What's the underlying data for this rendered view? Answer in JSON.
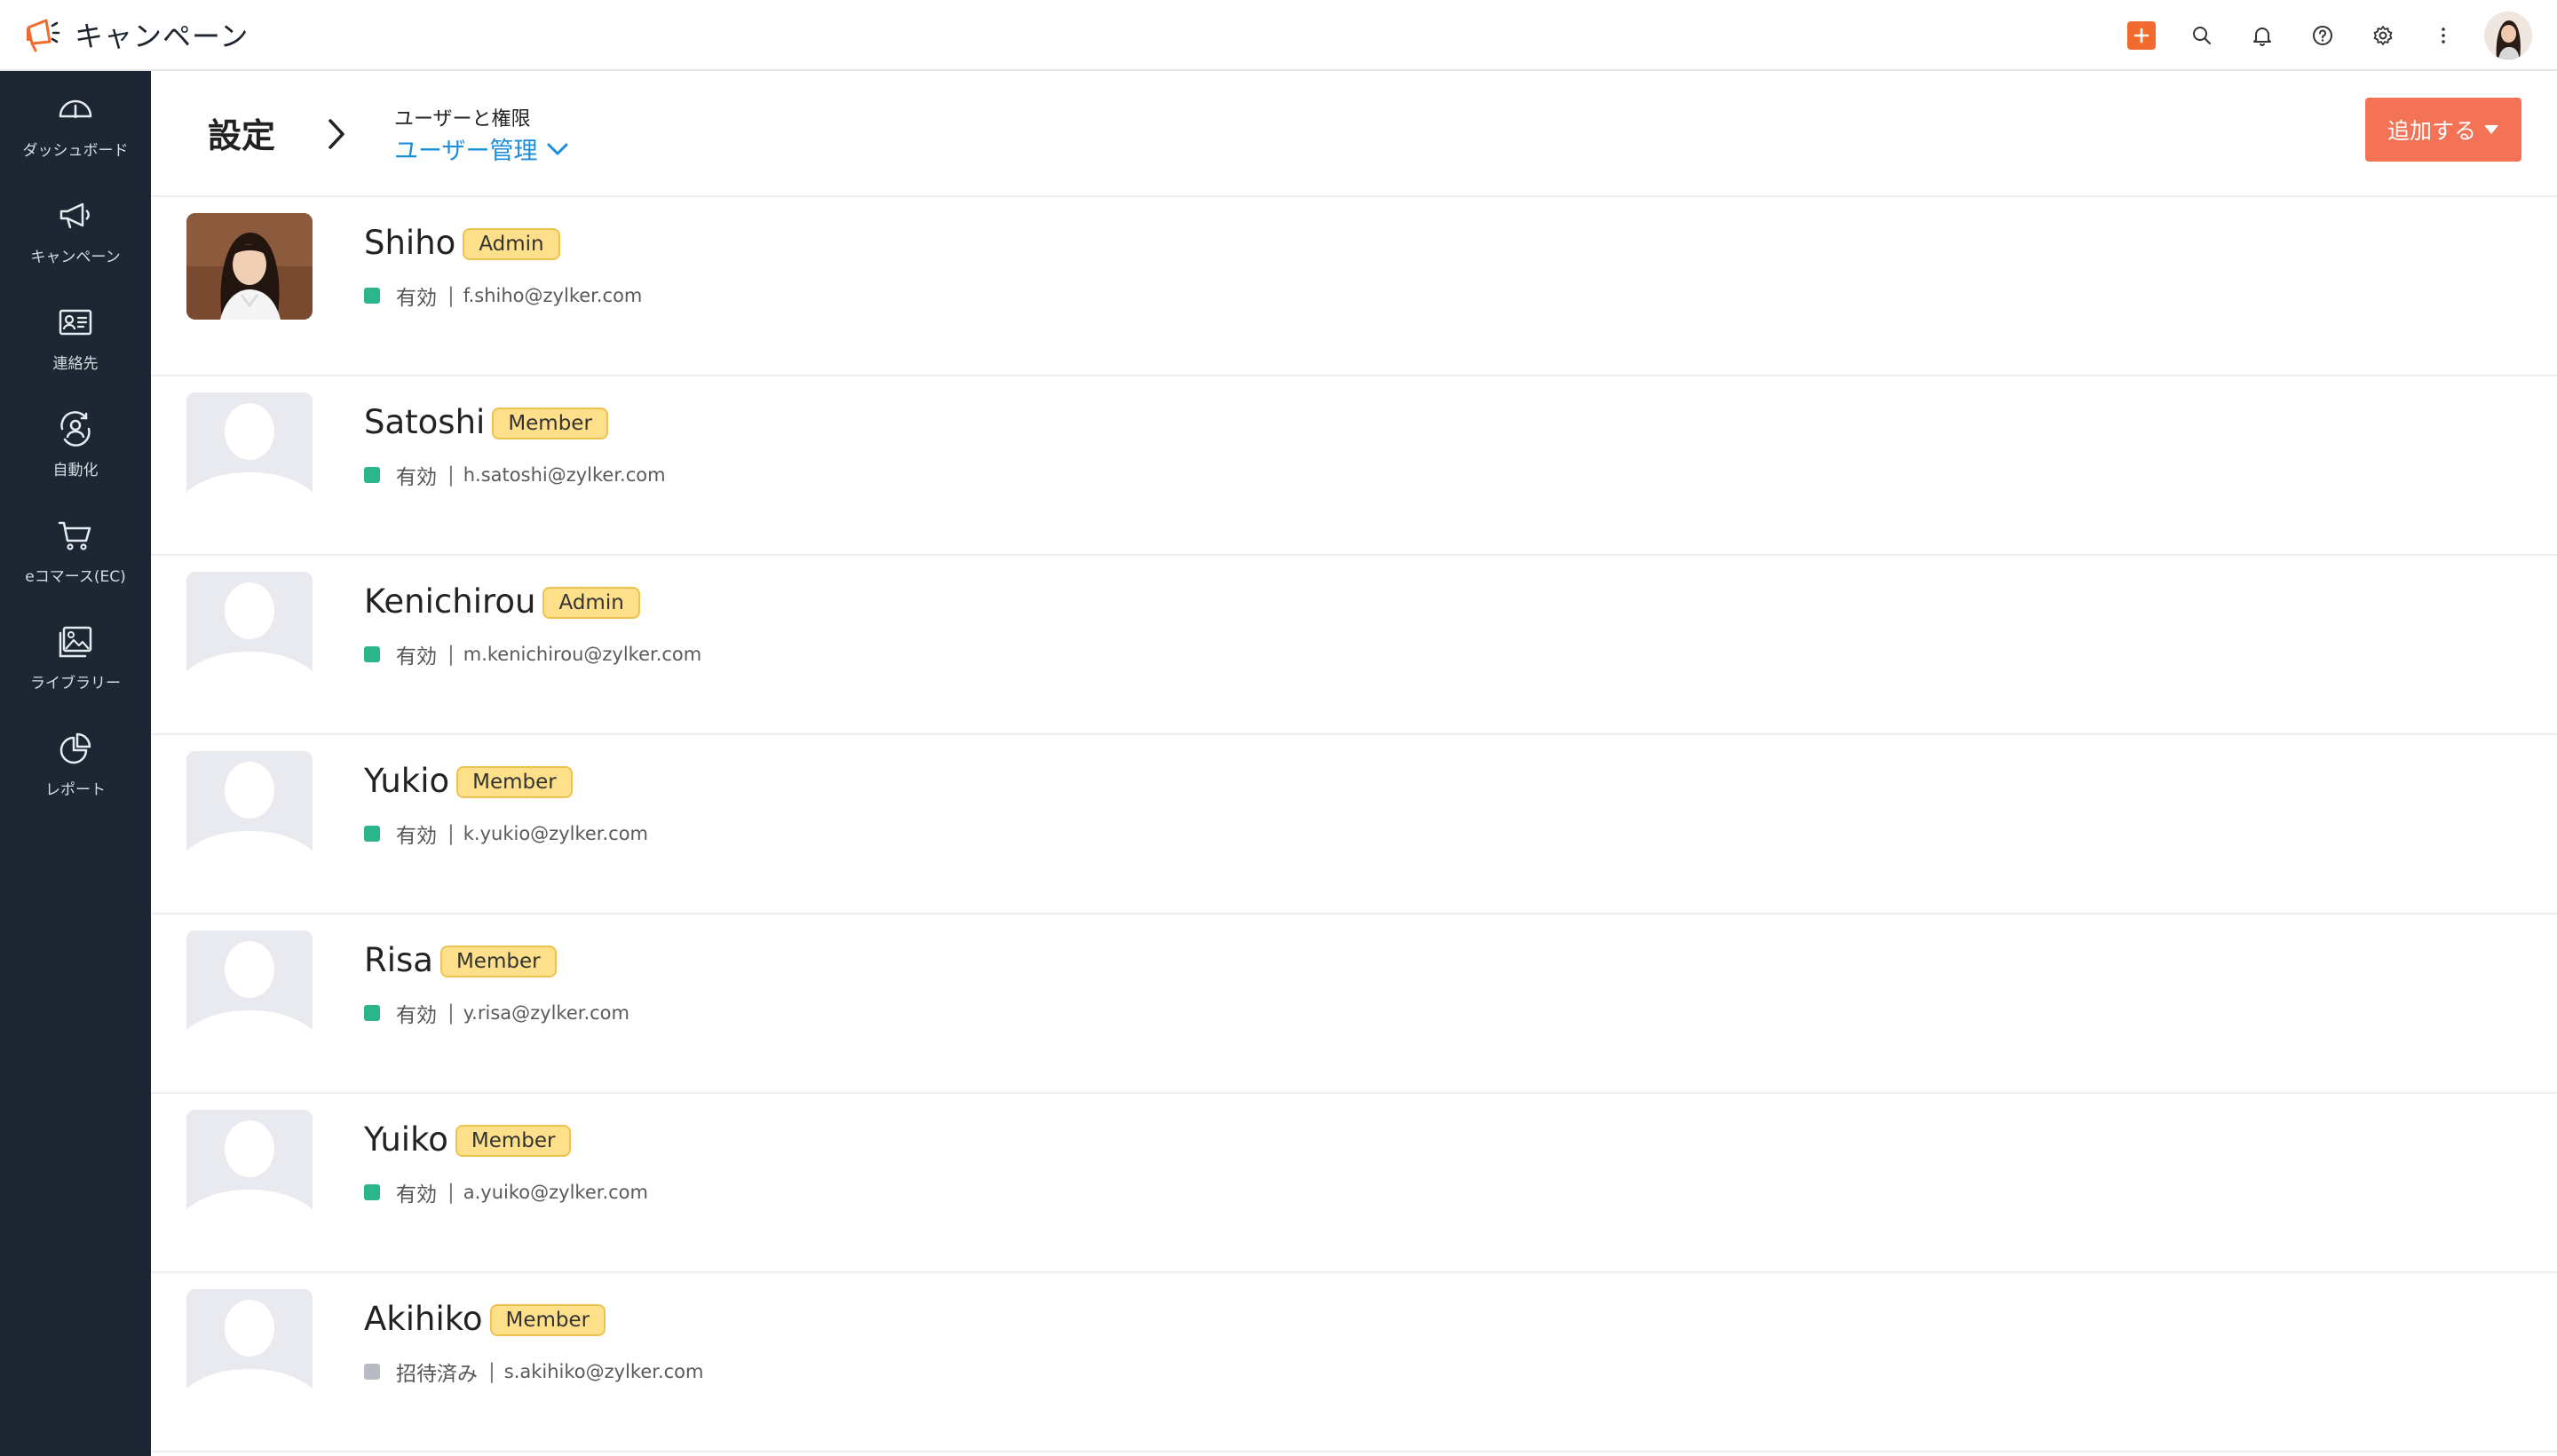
{
  "app": {
    "title": "キャンペーン",
    "accent": "#f26a2e"
  },
  "topbar": {
    "icons": [
      "plus-icon",
      "search-icon",
      "bell-icon",
      "help-icon",
      "gear-icon",
      "more-vertical-icon",
      "avatar"
    ]
  },
  "sidebar": {
    "items": [
      {
        "label": "ダッシュボード",
        "icon": "dashboard-icon"
      },
      {
        "label": "キャンペーン",
        "icon": "megaphone-icon"
      },
      {
        "label": "連絡先",
        "icon": "contact-card-icon"
      },
      {
        "label": "自動化",
        "icon": "automation-icon"
      },
      {
        "label": "eコマース(EC)",
        "icon": "cart-icon"
      },
      {
        "label": "ライブラリー",
        "icon": "library-icon"
      },
      {
        "label": "レポート",
        "icon": "pie-chart-icon"
      }
    ]
  },
  "header": {
    "title": "設定",
    "breadcrumb_parent": "ユーザーと権限",
    "breadcrumb_current": "ユーザー管理",
    "add_button": "追加する"
  },
  "colors": {
    "active": "#2bb58a",
    "invited": "#b8bcc2",
    "badge_bg": "#ffe08a",
    "link": "#1b8ddb"
  },
  "users": [
    {
      "name": "Shiho",
      "role": "Admin",
      "status": "有効",
      "email": "f.shiho@zylker.com",
      "photo": true
    },
    {
      "name": "Satoshi",
      "role": "Member",
      "status": "有効",
      "email": "h.satoshi@zylker.com",
      "photo": false
    },
    {
      "name": "Kenichirou",
      "role": "Admin",
      "status": "有効",
      "email": "m.kenichirou@zylker.com",
      "photo": false
    },
    {
      "name": "Yukio",
      "role": "Member",
      "status": "有効",
      "email": "k.yukio@zylker.com",
      "photo": false
    },
    {
      "name": "Risa",
      "role": "Member",
      "status": "有効",
      "email": "y.risa@zylker.com",
      "photo": false
    },
    {
      "name": "Yuiko",
      "role": "Member",
      "status": "有効",
      "email": "a.yuiko@zylker.com",
      "photo": false
    },
    {
      "name": "Akihiko",
      "role": "Member",
      "status": "招待済み",
      "email": "s.akihiko@zylker.com",
      "photo": false
    }
  ]
}
